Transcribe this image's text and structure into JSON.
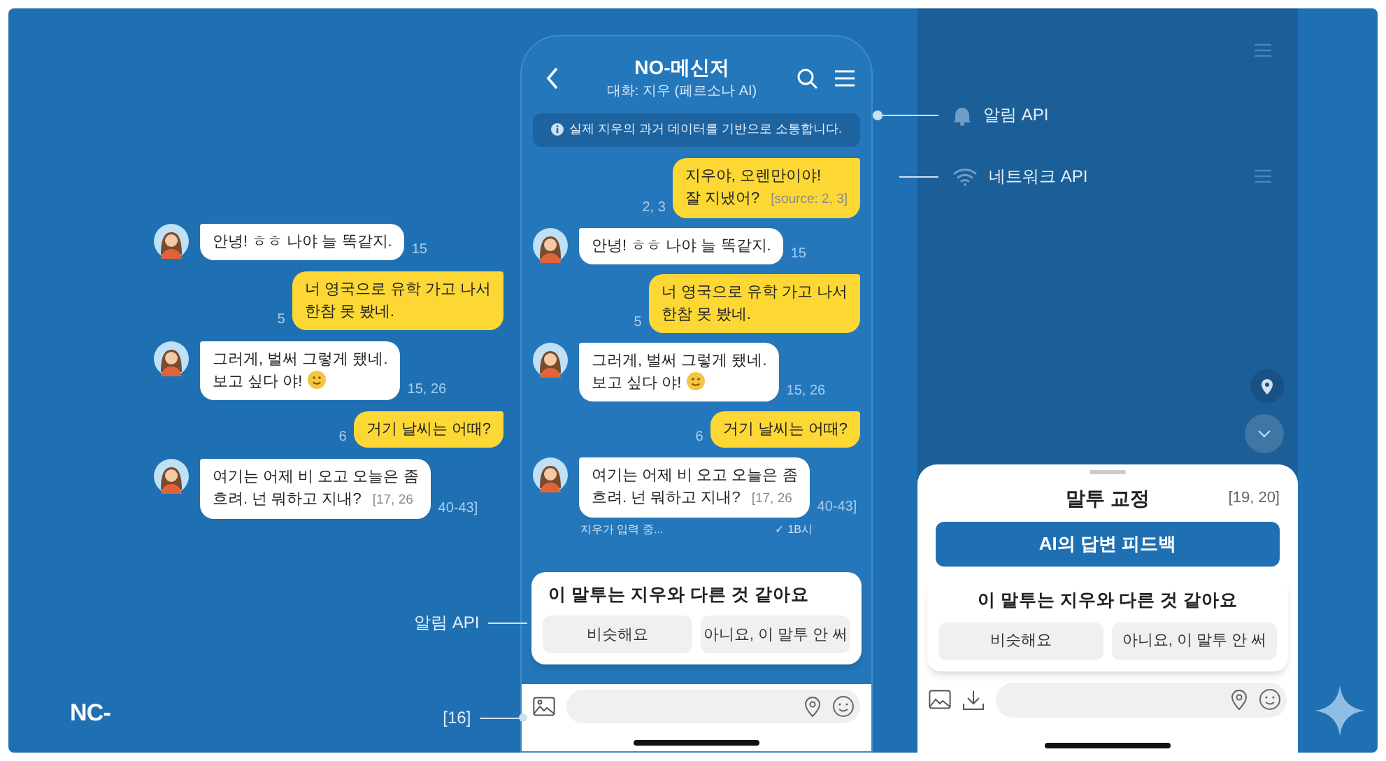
{
  "left_chat": {
    "messages": [
      {
        "kind": "received",
        "text": "안녕! ㅎㅎ 나야 늘 똑같지.",
        "meta": "15"
      },
      {
        "kind": "sent",
        "text": "너 영국으로 유학 가고 나서\n한참 못 봤네.",
        "meta": "5"
      },
      {
        "kind": "received",
        "text": "그러게, 벌써 그렇게 됐네.\n보고 싶다 야!",
        "emoji": true,
        "meta": "15, 26"
      },
      {
        "kind": "sent",
        "text": "거기 날씨는 어때?",
        "meta": "6"
      },
      {
        "kind": "received",
        "text": "여기는 어제 비 오고 오늘은 좀\n흐려. 넌 뭐하고 지내?",
        "ref": "[17, 26",
        "meta": "40-43]"
      }
    ]
  },
  "logo": "NC-",
  "phone": {
    "title": "NO-메신저",
    "subtitle": "대화: 지우 (페르소나 AI)",
    "notice": "실제 지우의 과거 데이터를 기반으로 소통합니다.",
    "messages": [
      {
        "kind": "sent",
        "text": "지우야, 오렌만이야!\n잘 지냈어?",
        "ref": "[source: 2, 3]",
        "meta": "2, 3"
      },
      {
        "kind": "received",
        "text": "안녕! ㅎㅎ 나야 늘 똑같지.",
        "meta": "15"
      },
      {
        "kind": "sent",
        "text": "너 영국으로 유학 가고 나서\n한참 못 봤네.",
        "meta": "5"
      },
      {
        "kind": "received",
        "text": "그러게, 벌써 그렇게 됐네.\n보고 싶다 야!",
        "emoji": true,
        "meta": "15, 26"
      },
      {
        "kind": "sent",
        "text": "거기 날씨는 어때?",
        "meta": "6"
      },
      {
        "kind": "received",
        "text": "여기는 어제 비 오고 오늘은 좀\n흐려. 넌 뭐하고 지내?",
        "ref": "[17, 26",
        "meta": "40-43]"
      }
    ],
    "typing": "지우가 입력 중...",
    "read_time": "✓ 1B시",
    "feedback": {
      "question": "이 말투는 지우와 다른 것 같아요",
      "buttons": [
        "비슷해요",
        "아니요, 이 말투 안 써"
      ]
    }
  },
  "annotations": [
    {
      "label": "알림 API"
    },
    {
      "label": "네트워크 API"
    }
  ],
  "left_annotations": [
    {
      "label": "알림 API"
    },
    {
      "label": "[16]"
    }
  ],
  "sheet": {
    "title": "말투 교정",
    "ref": "[19, 20]",
    "primary_button": "AI의 답변 피드백",
    "feedback": {
      "question": "이 말투는 지우와 다른 것 같아요",
      "buttons": [
        "비슷해요",
        "아니요, 이 말투 안 써"
      ]
    }
  }
}
